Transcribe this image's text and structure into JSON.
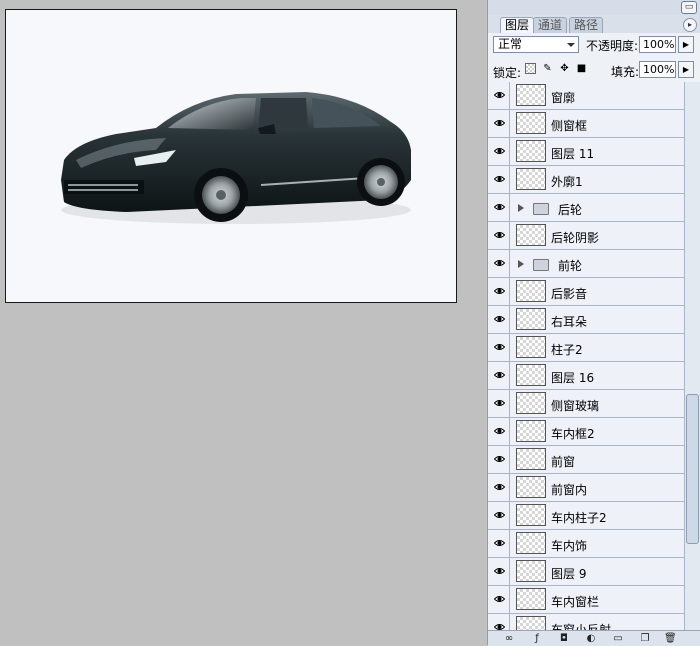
{
  "palette": {
    "tabs": [
      {
        "label": "图层",
        "active": true
      },
      {
        "label": "通道",
        "active": false
      },
      {
        "label": "路径",
        "active": false
      }
    ],
    "blend_mode": "正常",
    "opacity_label": "不透明度:",
    "opacity_value": "100%",
    "lock_label": "锁定:",
    "fill_label": "填充:",
    "fill_value": "100%"
  },
  "layers": [
    {
      "name": "窗廓",
      "type": "layer",
      "visible": true
    },
    {
      "name": "侧窗框",
      "type": "layer",
      "visible": true
    },
    {
      "name": "图层 11",
      "type": "layer",
      "visible": true
    },
    {
      "name": "外廓1",
      "type": "layer",
      "visible": true
    },
    {
      "name": "后轮",
      "type": "group",
      "visible": true
    },
    {
      "name": "后轮阴影",
      "type": "layer",
      "visible": true
    },
    {
      "name": "前轮",
      "type": "group",
      "visible": true
    },
    {
      "name": "后影音",
      "type": "layer",
      "visible": true
    },
    {
      "name": "右耳朵",
      "type": "layer",
      "visible": true
    },
    {
      "name": "柱子2",
      "type": "layer",
      "visible": true
    },
    {
      "name": "图层 16",
      "type": "layer",
      "visible": true
    },
    {
      "name": "侧窗玻璃",
      "type": "layer",
      "visible": true
    },
    {
      "name": "车内框2",
      "type": "layer",
      "visible": true
    },
    {
      "name": "前窗",
      "type": "layer",
      "visible": true
    },
    {
      "name": "前窗内",
      "type": "layer",
      "visible": true
    },
    {
      "name": "车内柱子2",
      "type": "layer",
      "visible": true
    },
    {
      "name": "车内饰",
      "type": "layer",
      "visible": true
    },
    {
      "name": "图层 9",
      "type": "layer",
      "visible": true
    },
    {
      "name": "车内窗栏",
      "type": "layer",
      "visible": true
    },
    {
      "name": "车窗小反射",
      "type": "layer",
      "visible": true
    }
  ],
  "icons": {
    "eye": "eye-icon",
    "folder": "folder-icon",
    "expand": "expand-arrow-icon",
    "lock_transparent": "lock-transparent-icon",
    "lock_brush": "brush-icon",
    "lock_move": "move-icon",
    "lock_all": "lock-icon",
    "bottom": [
      "link-icon",
      "layer-style-icon",
      "mask-icon",
      "adjustment-icon",
      "new-group-icon",
      "new-layer-icon",
      "trash-icon"
    ]
  },
  "colors": {
    "workspace": "#c0c0c0",
    "canvas": "#f7f8fb",
    "car_body": "#1f2a2e",
    "palette_bg": "#e9eef6"
  }
}
